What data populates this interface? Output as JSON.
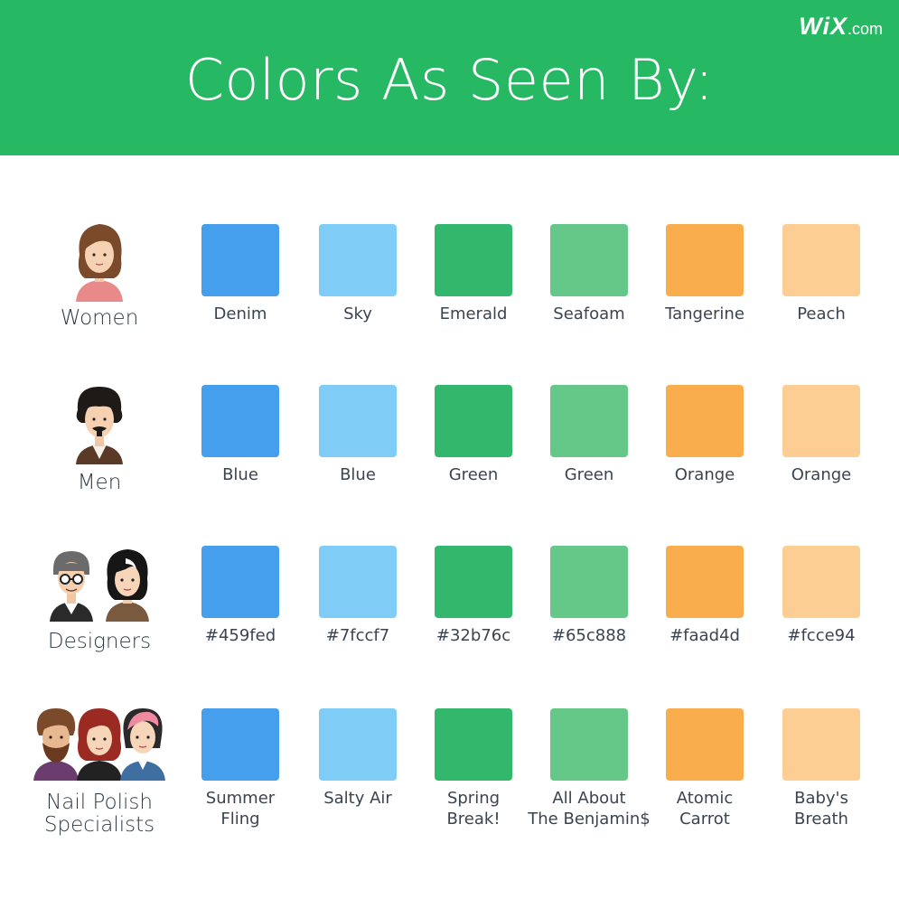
{
  "header": {
    "title": "Colors As Seen By:",
    "logo_main": "WiX",
    "logo_domain": ".com",
    "background": "#27b863"
  },
  "swatch_colors": [
    "#459fed",
    "#7fccf7",
    "#32b76c",
    "#65c888",
    "#faad4d",
    "#fcce94"
  ],
  "rows": [
    {
      "group": "Women",
      "avatar_icons": [
        "woman-avatar-icon"
      ],
      "labels": [
        "Denim",
        "Sky",
        "Emerald",
        "Seafoam",
        "Tangerine",
        "Peach"
      ]
    },
    {
      "group": "Men",
      "avatar_icons": [
        "man-avatar-icon"
      ],
      "labels": [
        "Blue",
        "Blue",
        "Green",
        "Green",
        "Orange",
        "Orange"
      ]
    },
    {
      "group": "Designers",
      "avatar_icons": [
        "designer-man-avatar-icon",
        "designer-woman-avatar-icon"
      ],
      "labels": [
        "#459fed",
        "#7fccf7",
        "#32b76c",
        "#65c888",
        "#faad4d",
        "#fcce94"
      ]
    },
    {
      "group": "Nail Polish\nSpecialists",
      "avatar_icons": [
        "bearded-man-avatar-icon",
        "redhead-woman-avatar-icon",
        "pink-hair-woman-avatar-icon"
      ],
      "labels": [
        "Summer\nFling",
        "Salty Air",
        "Spring\nBreak!",
        "All About\nThe Benjamin$",
        "Atomic\nCarrot",
        "Baby's\nBreath"
      ]
    }
  ]
}
